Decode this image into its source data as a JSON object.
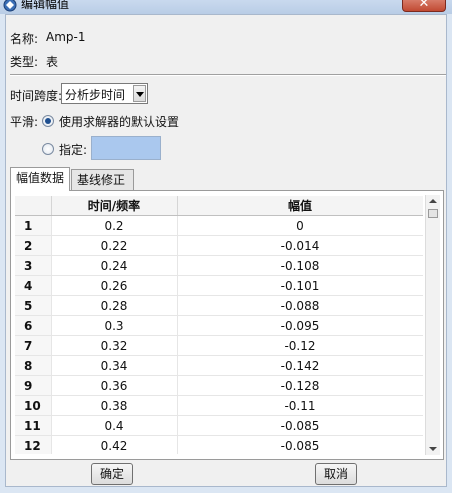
{
  "window": {
    "title": "编辑幅值",
    "close_glyph": "✕"
  },
  "form": {
    "name_label": "名称:",
    "name_value": "Amp-1",
    "type_label": "类型:",
    "type_value": "表",
    "time_span_label": "时间跨度:",
    "time_span_value": "分析步时间",
    "smoothing_label": "平滑:",
    "smoothing_default": "使用求解器的默认设置",
    "smoothing_specify": "指定:",
    "smoothing_selected": "default"
  },
  "tabs": [
    {
      "label": "幅值数据",
      "active": true
    },
    {
      "label": "基线修正",
      "active": false
    }
  ],
  "table": {
    "columns": [
      "",
      "时间/频率",
      "幅值"
    ],
    "rows": [
      [
        "1",
        "0.2",
        "0"
      ],
      [
        "2",
        "0.22",
        "-0.014"
      ],
      [
        "3",
        "0.24",
        "-0.108"
      ],
      [
        "4",
        "0.26",
        "-0.101"
      ],
      [
        "5",
        "0.28",
        "-0.088"
      ],
      [
        "6",
        "0.3",
        "-0.095"
      ],
      [
        "7",
        "0.32",
        "-0.12"
      ],
      [
        "8",
        "0.34",
        "-0.142"
      ],
      [
        "9",
        "0.36",
        "-0.128"
      ],
      [
        "10",
        "0.38",
        "-0.11"
      ],
      [
        "11",
        "0.4",
        "-0.085"
      ],
      [
        "12",
        "0.42",
        "-0.085"
      ]
    ]
  },
  "buttons": {
    "ok": "确定",
    "cancel": "取消"
  },
  "colors": {
    "title_bar": "#c9d9ee",
    "selected_input": "#aac8ee",
    "close_button": "#c14a33"
  }
}
